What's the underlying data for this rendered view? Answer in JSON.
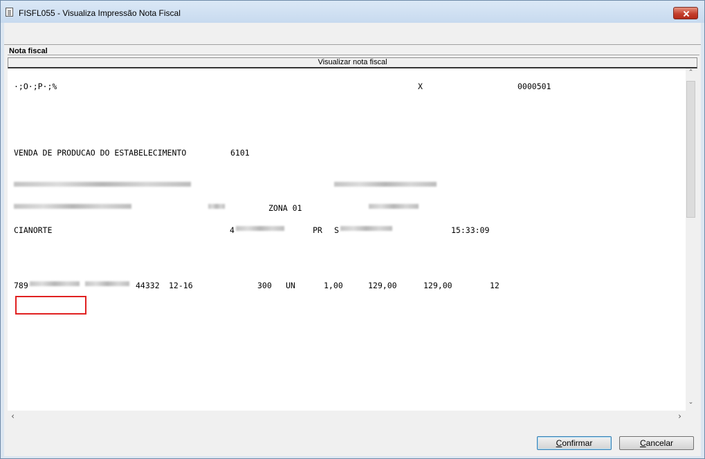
{
  "window": {
    "title": "FISFL055 - Visualiza Impressão Nota Fiscal"
  },
  "panel": {
    "label": "Nota fiscal",
    "view_header": "Visualizar nota fiscal"
  },
  "document": {
    "line1_code": "·;O·;P·;%",
    "line1_x": "X",
    "line1_number": "0000501",
    "operation": "VENDA DE PRODUCAO DO ESTABELECIMENTO",
    "cfop": "6101",
    "zona": "ZONA 01",
    "city": "CIANORTE",
    "city_prefix": "4",
    "state": "PR",
    "state_suffix": "S",
    "time": "15:33:09",
    "item": {
      "code_prefix": "789",
      "ref": "44332",
      "size": "12-16",
      "qty_col": "300",
      "unit": "UN",
      "quantity": "1,00",
      "unit_price": "129,00",
      "total": "129,00",
      "ipi": "12"
    }
  },
  "buttons": {
    "confirm_first": "C",
    "confirm_rest": "onfirmar",
    "cancel_first": "C",
    "cancel_rest": "ancelar"
  },
  "scroll": {
    "up_arrow": "⌃",
    "down_arrow": "⌄",
    "left_arrow": "‹",
    "right_arrow": "›"
  }
}
